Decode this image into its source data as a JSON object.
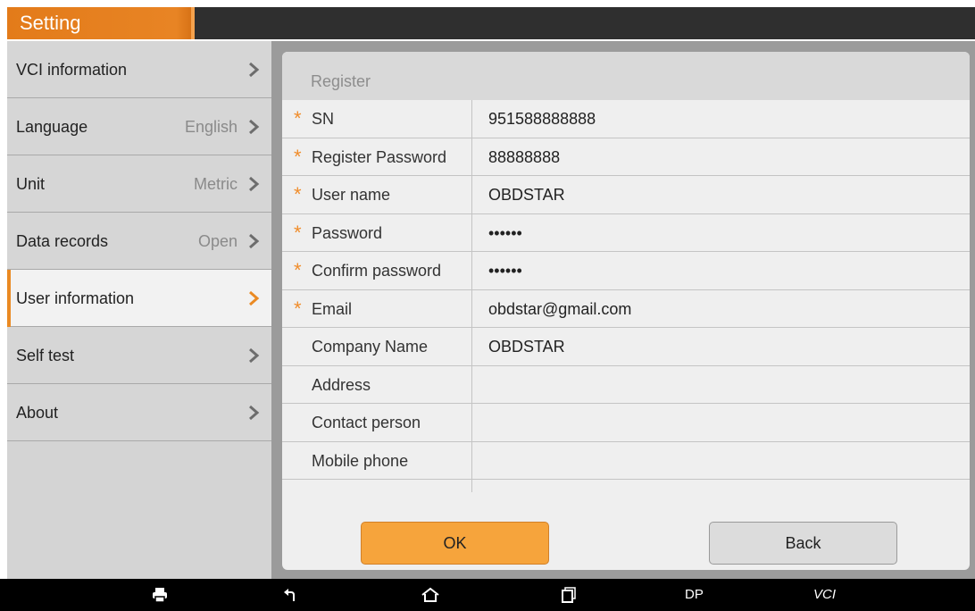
{
  "header": {
    "title": "Setting"
  },
  "sidebar": {
    "items": [
      {
        "label": "VCI information",
        "value": ""
      },
      {
        "label": "Language",
        "value": "English"
      },
      {
        "label": "Unit",
        "value": "Metric"
      },
      {
        "label": "Data records",
        "value": "Open"
      },
      {
        "label": "User information",
        "value": ""
      },
      {
        "label": "Self test",
        "value": ""
      },
      {
        "label": "About",
        "value": ""
      }
    ]
  },
  "form": {
    "title": "Register",
    "required_marker": "*",
    "fields": [
      {
        "label": "SN",
        "value": "951588888888"
      },
      {
        "label": "Register Password",
        "value": "88888888"
      },
      {
        "label": "User name",
        "value": "OBDSTAR"
      },
      {
        "label": "Password",
        "value": "••••••"
      },
      {
        "label": "Confirm password",
        "value": "••••••"
      },
      {
        "label": "Email",
        "value": "obdstar@gmail.com"
      },
      {
        "label": "Company Name",
        "value": "OBDSTAR"
      },
      {
        "label": "Address",
        "value": ""
      },
      {
        "label": "Contact person",
        "value": ""
      },
      {
        "label": "Mobile phone",
        "value": ""
      }
    ],
    "ok_label": "OK",
    "back_label": "Back"
  },
  "navbar": {
    "dp_label": "DP",
    "vci_label": "VCI"
  },
  "colors": {
    "accent": "#ea8a23",
    "button_ok": "#f6a43c"
  }
}
